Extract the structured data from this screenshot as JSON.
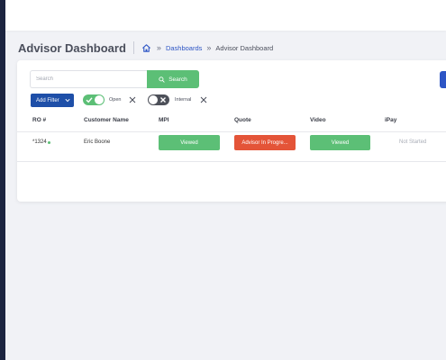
{
  "colors": {
    "rail": "#1c2440",
    "accent_blue": "#2d55c5",
    "success_green": "#5cbf76",
    "danger_red": "#e45438",
    "toggle_off": "#4d5059"
  },
  "header": {
    "title": "Advisor Dashboard",
    "breadcrumb": {
      "home_icon": "home-icon",
      "separator": "»",
      "link": "Dashboards",
      "current": "Advisor Dashboard"
    }
  },
  "search": {
    "placeholder": "Search",
    "value": "",
    "button_label": "Search",
    "button_icon": "search-icon"
  },
  "filters": {
    "add_filter_label": "Add Filter",
    "chips": [
      {
        "label": "Open",
        "enabled": true
      },
      {
        "label": "Internal",
        "enabled": false
      }
    ]
  },
  "table": {
    "columns": [
      "RO #",
      "Customer Name",
      "MPI",
      "Quote",
      "Video",
      "iPay"
    ],
    "rows": [
      {
        "ro": "*1324",
        "customer": "Eric Boone",
        "mpi": "Viewed",
        "quote": "Advisor In Progre...",
        "video": "Viewed",
        "ipay": "Not Started"
      }
    ]
  }
}
